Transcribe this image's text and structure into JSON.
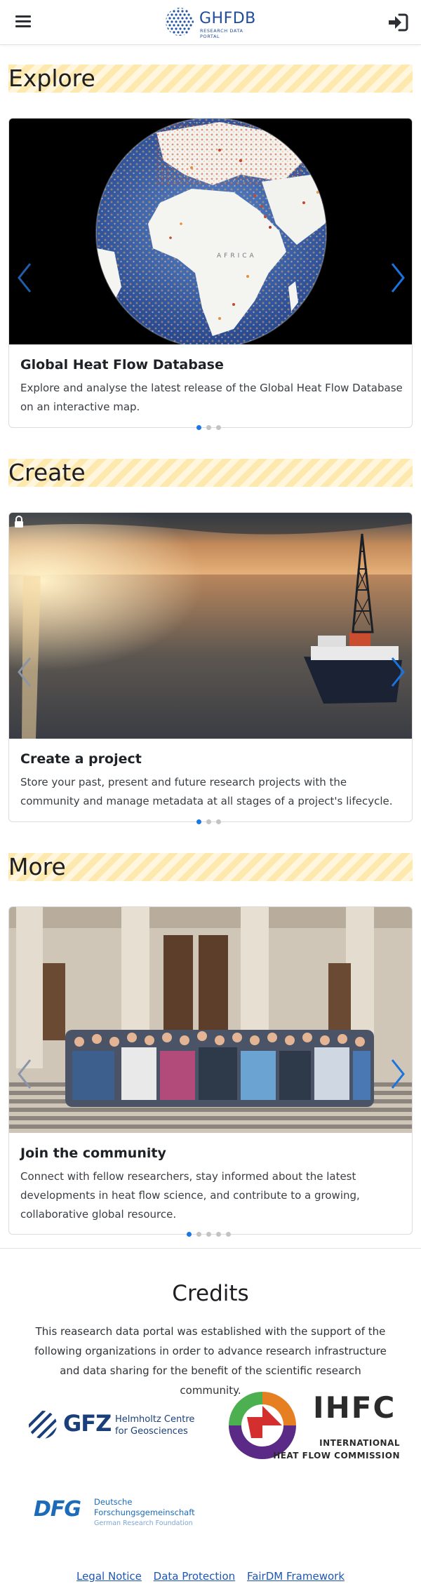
{
  "header": {
    "logo_text": "GHFDB",
    "logo_subtext": "RESEARCH DATA PORTAL"
  },
  "sections": [
    {
      "title": "Explore",
      "card": {
        "title": "Global Heat Flow Database",
        "text": "Explore and analyse the latest release of the Global Heat Flow Database on an interactive map.",
        "map_label": "AFRICA",
        "slides": 3,
        "active_slide": 1
      }
    },
    {
      "title": "Create",
      "card": {
        "title": "Create a project",
        "text": "Store your past, present and future research projects with the community and manage metadata at all stages of a project's lifecycle.",
        "slides": 3,
        "active_slide": 1
      }
    },
    {
      "title": "More",
      "card": {
        "title": "Join the community",
        "text": "Connect with fellow researchers, stay informed about the latest developments in heat flow science, and contribute to a growing, collaborative global resource.",
        "slides": 5,
        "active_slide": 1
      }
    }
  ],
  "credits": {
    "title": "Credits",
    "text": "This reasearch data portal was established with the support of the following organizations in order to advance research infrastructure and data sharing for the benefit of the scientific research community.",
    "logos": {
      "gfz": {
        "mark": "GFZ",
        "line1": "Helmholtz Centre",
        "line2": "for Geosciences"
      },
      "ihfc": {
        "mark": "IHFC",
        "line1": "INTERNATIONAL",
        "line2": "HEAT FLOW COMMISSION"
      },
      "dfg": {
        "mark": "DFG",
        "line1": "Deutsche",
        "line2": "Forschungsgemeinschaft",
        "line3": "German Research Foundation"
      }
    }
  },
  "footer": {
    "links": [
      "Legal Notice",
      "Data Protection",
      "FairDM Framework"
    ]
  },
  "colors": {
    "brand_blue": "#1e4b9a",
    "active_dot": "#1978e5",
    "stripe_yellow": "#fde9ae",
    "link": "#1e56b3"
  }
}
